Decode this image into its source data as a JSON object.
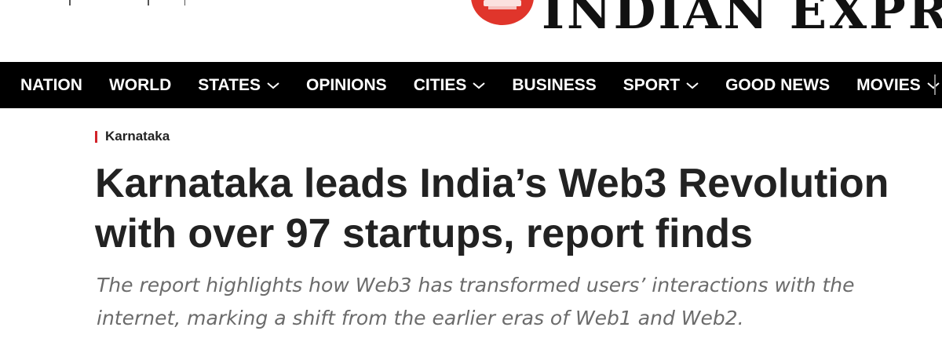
{
  "masthead": {
    "logo_text": "INDIAN EXPRES"
  },
  "nav": {
    "items": [
      {
        "label": "NATION",
        "dropdown": false
      },
      {
        "label": "WORLD",
        "dropdown": false
      },
      {
        "label": "STATES",
        "dropdown": true
      },
      {
        "label": "OPINIONS",
        "dropdown": false
      },
      {
        "label": "CITIES",
        "dropdown": true
      },
      {
        "label": "BUSINESS",
        "dropdown": false
      },
      {
        "label": "SPORT",
        "dropdown": true
      },
      {
        "label": "GOOD NEWS",
        "dropdown": false
      },
      {
        "label": "MOVIES",
        "dropdown": true
      }
    ]
  },
  "article": {
    "category": "Karnataka",
    "headline": "Karnataka leads India’s Web3 Revolution with over 97 startups, report finds",
    "subheadline": "The report highlights how Web3 has transformed users’ interactions with the internet, marking a shift from the earlier eras of Web1 and Web2."
  },
  "colors": {
    "accent_red": "#d2232a",
    "nav_background": "#000000",
    "headline_text": "#222222",
    "subheadline_text": "#6b6b6b"
  }
}
